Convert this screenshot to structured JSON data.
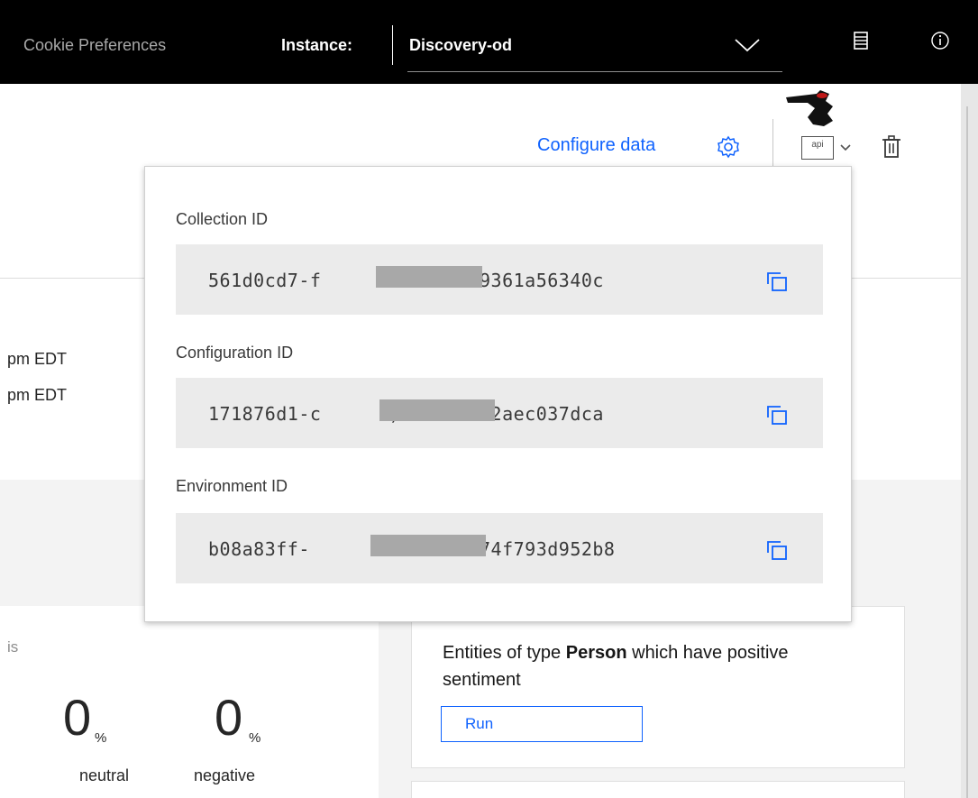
{
  "topbar": {
    "cookie_label": "Cookie Preferences",
    "instance_label": "Instance:",
    "instance_value": "Discovery-od",
    "icons": [
      "chevron-down-icon",
      "docs-icon",
      "info-icon"
    ]
  },
  "toolbar": {
    "configure_label": "Configure data",
    "api_label": "api"
  },
  "popover": {
    "fields": [
      {
        "label": "Collection ID",
        "value": "561d0cd7-f      5-8f2f-49361a56340c"
      },
      {
        "label": "Configuration ID",
        "value": "171876d1-c      )-a1f5-fe2aec037dca"
      },
      {
        "label": "Environment ID",
        "value": "b08a83ff-      u2d-a02c-74f793d952b8"
      }
    ]
  },
  "background": {
    "time_a": "pm EDT",
    "time_b": "pm EDT",
    "analysis_fragment": "is",
    "stats": [
      {
        "value": "0",
        "unit": "%",
        "label": "neutral"
      },
      {
        "value": "0",
        "unit": "%",
        "label": "negative"
      }
    ],
    "query_card": {
      "text_before": "Entities of type ",
      "text_bold": "Person",
      "text_after": " which have positive sentiment",
      "run_label": "Run"
    }
  },
  "colors": {
    "topbar_bg": "#000000",
    "link_blue": "#0f62fe",
    "id_field_bg": "#ebebeb"
  }
}
